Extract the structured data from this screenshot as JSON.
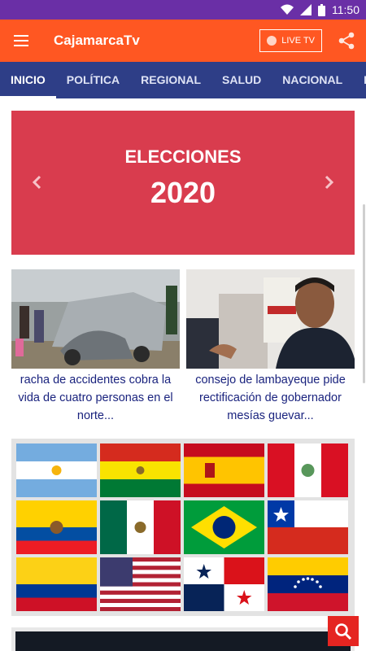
{
  "status_bar": {
    "time": "11:50",
    "icons": [
      "wifi-icon",
      "signal-icon",
      "battery-icon"
    ]
  },
  "app_bar": {
    "title": "CajamarcaTv",
    "live_label": "LIVE TV",
    "menu_icon": "hamburger-menu-icon",
    "share_icon": "share-icon"
  },
  "tabs": [
    {
      "label": "INICIO",
      "active": true
    },
    {
      "label": "POLÍTICA",
      "active": false
    },
    {
      "label": "REGIONAL",
      "active": false
    },
    {
      "label": "SALUD",
      "active": false
    },
    {
      "label": "NACIONAL",
      "active": false
    },
    {
      "label": "INTERNACIONAL",
      "active": false
    }
  ],
  "banner": {
    "title": "ELECCIONES",
    "year": "2020",
    "color": "#d93c4e"
  },
  "news": [
    {
      "title": "racha de accidentes cobra la vida de cuatro personas en el norte..."
    },
    {
      "title": "consejo de lambayeque pide rectificación de gobernador mesías guevar..."
    }
  ],
  "flags": [
    "Argentina",
    "Bolivia",
    "España",
    "Perú",
    "Ecuador",
    "México",
    "Brasil",
    "Chile",
    "Colombia",
    "Estados Unidos",
    "Panamá",
    "Venezuela"
  ],
  "colors": {
    "status_bar": "#6a2fa6",
    "app_bar": "#ff5722",
    "tabs": "#2e3e87",
    "news_text": "#1a237e",
    "search_fab": "#e52521"
  }
}
